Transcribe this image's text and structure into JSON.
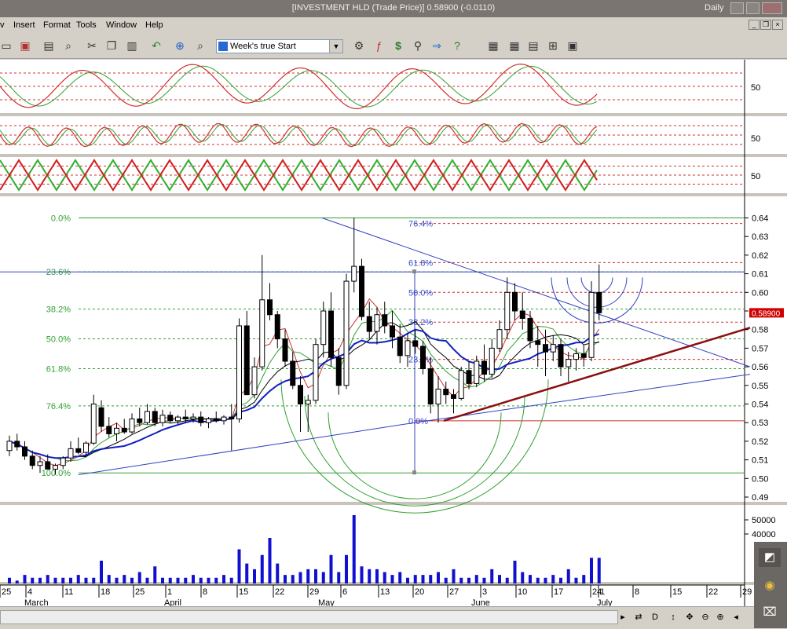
{
  "window": {
    "title": "[INVESTMENT HLD (Trade Price)]   0.58900 (-0.0110)",
    "period": "Daily"
  },
  "menu": [
    "v",
    "Insert",
    "Format",
    "Tools",
    "Window",
    "Help"
  ],
  "toolbar": {
    "combo_value": "Week's true Start"
  },
  "price_label": "0.58900",
  "chart_data": {
    "type": "candlestick",
    "price_axis": {
      "range": [
        0.49,
        0.645
      ],
      "ticks": [
        "0.64",
        "0.63",
        "0.62",
        "0.61",
        "0.60",
        "0.59",
        "0.58",
        "0.57",
        "0.56",
        "0.55",
        "0.54",
        "0.53",
        "0.52",
        "0.51",
        "0.50",
        "0.49"
      ]
    },
    "volume_axis": {
      "ticks": [
        "50000",
        "40000"
      ]
    },
    "oscillator_labels": [
      "50",
      "50",
      "50"
    ],
    "fib_left": [
      {
        "label": "0.0%",
        "price": 0.64
      },
      {
        "label": "23.6%",
        "price": 0.611
      },
      {
        "label": "38.2%",
        "price": 0.591
      },
      {
        "label": "50.0%",
        "price": 0.575
      },
      {
        "label": "61.8%",
        "price": 0.559
      },
      {
        "label": "76.4%",
        "price": 0.539
      },
      {
        "label": "100.0%",
        "price": 0.503
      }
    ],
    "fib_right": [
      {
        "label": "76.4%",
        "price": 0.637
      },
      {
        "label": "61.8%",
        "price": 0.616
      },
      {
        "label": "50.0%",
        "price": 0.6
      },
      {
        "label": "38.2%",
        "price": 0.584
      },
      {
        "label": "23.6%",
        "price": 0.564
      },
      {
        "label": "0.0%",
        "price": 0.531
      }
    ],
    "date_ticks": [
      "25",
      "4",
      "11",
      "18",
      "25",
      "1",
      "8",
      "15",
      "22",
      "29",
      "6",
      "13",
      "20",
      "27",
      "3",
      "10",
      "17",
      "24",
      "1",
      "8",
      "15",
      "22",
      "29"
    ],
    "month_labels": [
      "March",
      "April",
      "May",
      "June",
      "July"
    ],
    "candles": [
      [
        0.515,
        0.523,
        0.512,
        0.52
      ],
      [
        0.52,
        0.524,
        0.515,
        0.517
      ],
      [
        0.517,
        0.52,
        0.51,
        0.512
      ],
      [
        0.512,
        0.515,
        0.505,
        0.507
      ],
      [
        0.507,
        0.512,
        0.503,
        0.509
      ],
      [
        0.509,
        0.513,
        0.505,
        0.505
      ],
      [
        0.505,
        0.508,
        0.502,
        0.507
      ],
      [
        0.507,
        0.512,
        0.505,
        0.511
      ],
      [
        0.511,
        0.52,
        0.509,
        0.516
      ],
      [
        0.516,
        0.522,
        0.513,
        0.514
      ],
      [
        0.514,
        0.52,
        0.512,
        0.519
      ],
      [
        0.519,
        0.545,
        0.518,
        0.54
      ],
      [
        0.538,
        0.542,
        0.525,
        0.528
      ],
      [
        0.528,
        0.533,
        0.522,
        0.524
      ],
      [
        0.524,
        0.53,
        0.52,
        0.527
      ],
      [
        0.527,
        0.532,
        0.524,
        0.525
      ],
      [
        0.525,
        0.535,
        0.524,
        0.532
      ],
      [
        0.532,
        0.538,
        0.528,
        0.53
      ],
      [
        0.53,
        0.54,
        0.529,
        0.536
      ],
      [
        0.536,
        0.538,
        0.528,
        0.53
      ],
      [
        0.53,
        0.537,
        0.528,
        0.534
      ],
      [
        0.534,
        0.536,
        0.53,
        0.531
      ],
      [
        0.531,
        0.534,
        0.529,
        0.533
      ],
      [
        0.533,
        0.537,
        0.53,
        0.532
      ],
      [
        0.532,
        0.535,
        0.53,
        0.533
      ],
      [
        0.533,
        0.536,
        0.528,
        0.53
      ],
      [
        0.53,
        0.533,
        0.527,
        0.532
      ],
      [
        0.532,
        0.536,
        0.53,
        0.531
      ],
      [
        0.531,
        0.534,
        0.529,
        0.533
      ],
      [
        0.533,
        0.54,
        0.515,
        0.532
      ],
      [
        0.532,
        0.586,
        0.53,
        0.582
      ],
      [
        0.582,
        0.59,
        0.56,
        0.545
      ],
      [
        0.545,
        0.565,
        0.543,
        0.56
      ],
      [
        0.56,
        0.62,
        0.558,
        0.596
      ],
      [
        0.596,
        0.605,
        0.585,
        0.588
      ],
      [
        0.588,
        0.59,
        0.57,
        0.575
      ],
      [
        0.575,
        0.58,
        0.56,
        0.563
      ],
      [
        0.563,
        0.568,
        0.548,
        0.55
      ],
      [
        0.55,
        0.555,
        0.525,
        0.54
      ],
      [
        0.54,
        0.545,
        0.525,
        0.542
      ],
      [
        0.542,
        0.575,
        0.54,
        0.572
      ],
      [
        0.572,
        0.595,
        0.565,
        0.59
      ],
      [
        0.59,
        0.6,
        0.56,
        0.565
      ],
      [
        0.565,
        0.57,
        0.545,
        0.55
      ],
      [
        0.55,
        0.61,
        0.548,
        0.606
      ],
      [
        0.606,
        0.64,
        0.6,
        0.614
      ],
      [
        0.614,
        0.618,
        0.585,
        0.587
      ],
      [
        0.587,
        0.595,
        0.575,
        0.579
      ],
      [
        0.579,
        0.592,
        0.572,
        0.588
      ],
      [
        0.588,
        0.595,
        0.578,
        0.582
      ],
      [
        0.582,
        0.59,
        0.57,
        0.576
      ],
      [
        0.576,
        0.583,
        0.562,
        0.566
      ],
      [
        0.566,
        0.578,
        0.56,
        0.574
      ],
      [
        0.574,
        0.58,
        0.567,
        0.571
      ],
      [
        0.571,
        0.574,
        0.556,
        0.559
      ],
      [
        0.559,
        0.565,
        0.535,
        0.54
      ],
      [
        0.54,
        0.555,
        0.53,
        0.548
      ],
      [
        0.548,
        0.552,
        0.54,
        0.545
      ],
      [
        0.545,
        0.548,
        0.535,
        0.543
      ],
      [
        0.543,
        0.56,
        0.542,
        0.558
      ],
      [
        0.558,
        0.563,
        0.548,
        0.551
      ],
      [
        0.551,
        0.566,
        0.549,
        0.563
      ],
      [
        0.563,
        0.572,
        0.552,
        0.556
      ],
      [
        0.556,
        0.575,
        0.554,
        0.57
      ],
      [
        0.57,
        0.585,
        0.568,
        0.58
      ],
      [
        0.58,
        0.608,
        0.575,
        0.6
      ],
      [
        0.6,
        0.605,
        0.585,
        0.59
      ],
      [
        0.59,
        0.6,
        0.58,
        0.586
      ],
      [
        0.586,
        0.59,
        0.57,
        0.574
      ],
      [
        0.574,
        0.582,
        0.56,
        0.572
      ],
      [
        0.572,
        0.58,
        0.555,
        0.568
      ],
      [
        0.568,
        0.577,
        0.563,
        0.572
      ],
      [
        0.572,
        0.575,
        0.555,
        0.56
      ],
      [
        0.56,
        0.568,
        0.552,
        0.564
      ],
      [
        0.564,
        0.57,
        0.558,
        0.567
      ],
      [
        0.567,
        0.572,
        0.56,
        0.565
      ],
      [
        0.565,
        0.606,
        0.563,
        0.6
      ],
      [
        0.6,
        0.615,
        0.585,
        0.589
      ]
    ],
    "volume": [
      2,
      1,
      3,
      2,
      2,
      3,
      2,
      2,
      2,
      3,
      2,
      2,
      8,
      3,
      2,
      3,
      2,
      4,
      2,
      6,
      2,
      2,
      2,
      2,
      3,
      2,
      2,
      2,
      3,
      2,
      12,
      7,
      5,
      10,
      16,
      7,
      3,
      3,
      4,
      5,
      5,
      4,
      10,
      4,
      10,
      24,
      6,
      5,
      5,
      4,
      3,
      4,
      2,
      3,
      3,
      3,
      4,
      2,
      5,
      2,
      2,
      3,
      2,
      5,
      3,
      2,
      8,
      4,
      3,
      2,
      2,
      3,
      2,
      5,
      2,
      3,
      9,
      9
    ]
  }
}
